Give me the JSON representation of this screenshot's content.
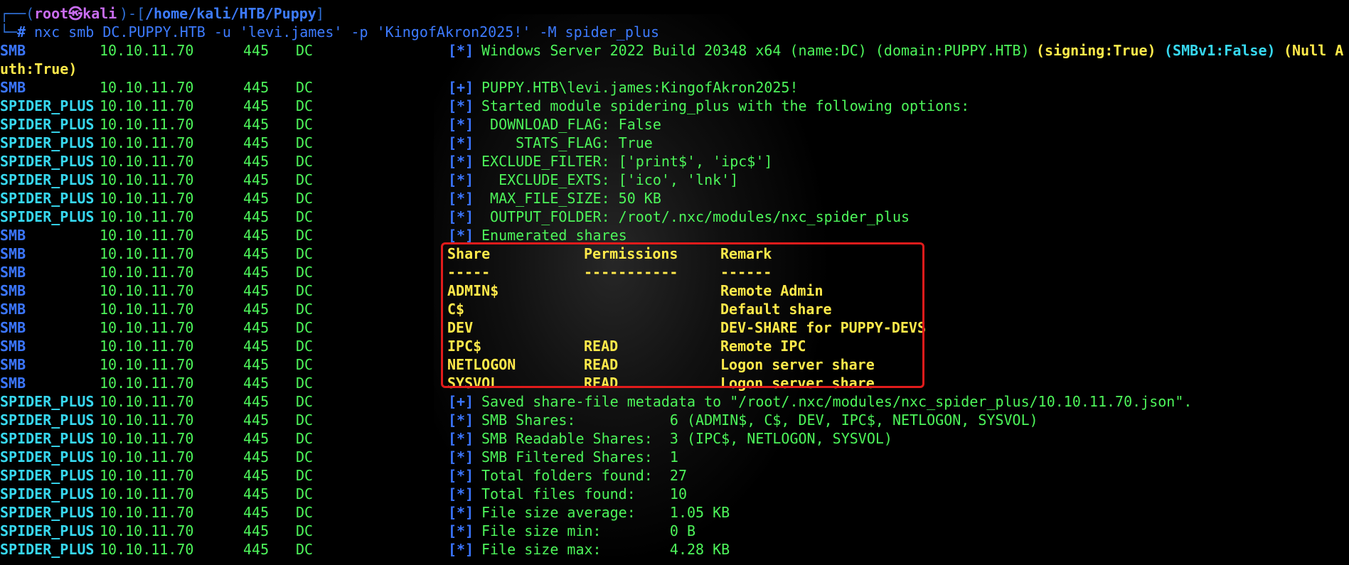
{
  "prompt": {
    "open": "┌──(",
    "user": "root㉿kali",
    "mid": ")-[",
    "path": "/home/kali/HTB/Puppy",
    "close": "]",
    "lead": "└─",
    "symbol": "#",
    "command": "nxc smb DC.PUPPY.HTB -u 'levi.james' -p 'KingofAkron2025!' -M spider_plus"
  },
  "rows": [
    {
      "proto": "SMB",
      "kind": "smb",
      "ip": "10.10.11.70",
      "port": "445",
      "host": "DC",
      "tag": "[*]",
      "msg": "Windows Server 2022 Build 20348 x64 (name:DC) (domain:PUPPY.HTB) ",
      "msg2": "(signing:True) ",
      "msg3": "(SMBv1:False) ",
      "msg4": "(Null A"
    },
    {
      "wrap": "uth:True)"
    },
    {
      "proto": "SMB",
      "kind": "smb",
      "ip": "10.10.11.70",
      "port": "445",
      "host": "DC",
      "tag": "[+]",
      "msg": "PUPPY.HTB\\levi.james:KingofAkron2025!"
    },
    {
      "proto": "SPIDER_PLUS",
      "kind": "spider",
      "ip": "10.10.11.70",
      "port": "445",
      "host": "DC",
      "tag": "[*]",
      "msg": "Started module spidering_plus with the following options:"
    },
    {
      "proto": "SPIDER_PLUS",
      "kind": "spider",
      "ip": "10.10.11.70",
      "port": "445",
      "host": "DC",
      "tag": "[*]",
      "msg": " DOWNLOAD_FLAG: False"
    },
    {
      "proto": "SPIDER_PLUS",
      "kind": "spider",
      "ip": "10.10.11.70",
      "port": "445",
      "host": "DC",
      "tag": "[*]",
      "msg": "    STATS_FLAG: True"
    },
    {
      "proto": "SPIDER_PLUS",
      "kind": "spider",
      "ip": "10.10.11.70",
      "port": "445",
      "host": "DC",
      "tag": "[*]",
      "msg": "EXCLUDE_FILTER: ['print$', 'ipc$']"
    },
    {
      "proto": "SPIDER_PLUS",
      "kind": "spider",
      "ip": "10.10.11.70",
      "port": "445",
      "host": "DC",
      "tag": "[*]",
      "msg": "  EXCLUDE_EXTS: ['ico', 'lnk']"
    },
    {
      "proto": "SPIDER_PLUS",
      "kind": "spider",
      "ip": "10.10.11.70",
      "port": "445",
      "host": "DC",
      "tag": "[*]",
      "msg": " MAX_FILE_SIZE: 50 KB"
    },
    {
      "proto": "SPIDER_PLUS",
      "kind": "spider",
      "ip": "10.10.11.70",
      "port": "445",
      "host": "DC",
      "tag": "[*]",
      "msg": " OUTPUT_FOLDER: /root/.nxc/modules/nxc_spider_plus"
    },
    {
      "proto": "SMB",
      "kind": "smb",
      "ip": "10.10.11.70",
      "port": "445",
      "host": "DC",
      "tag": "[*]",
      "msg": "Enumerated shares"
    },
    {
      "proto": "SMB",
      "kind": "smb",
      "ip": "10.10.11.70",
      "port": "445",
      "host": "DC",
      "share": "Share",
      "perm": "Permissions",
      "remark": "Remark"
    },
    {
      "proto": "SMB",
      "kind": "smb",
      "ip": "10.10.11.70",
      "port": "445",
      "host": "DC",
      "share": "-----",
      "perm": "-----------",
      "remark": "------"
    },
    {
      "proto": "SMB",
      "kind": "smb",
      "ip": "10.10.11.70",
      "port": "445",
      "host": "DC",
      "share": "ADMIN$",
      "perm": "",
      "remark": "Remote Admin"
    },
    {
      "proto": "SMB",
      "kind": "smb",
      "ip": "10.10.11.70",
      "port": "445",
      "host": "DC",
      "share": "C$",
      "perm": "",
      "remark": "Default share"
    },
    {
      "proto": "SMB",
      "kind": "smb",
      "ip": "10.10.11.70",
      "port": "445",
      "host": "DC",
      "share": "DEV",
      "perm": "",
      "remark": "DEV-SHARE for PUPPY-DEVS"
    },
    {
      "proto": "SMB",
      "kind": "smb",
      "ip": "10.10.11.70",
      "port": "445",
      "host": "DC",
      "share": "IPC$",
      "perm": "READ",
      "remark": "Remote IPC"
    },
    {
      "proto": "SMB",
      "kind": "smb",
      "ip": "10.10.11.70",
      "port": "445",
      "host": "DC",
      "share": "NETLOGON",
      "perm": "READ",
      "remark": "Logon server share"
    },
    {
      "proto": "SMB",
      "kind": "smb",
      "ip": "10.10.11.70",
      "port": "445",
      "host": "DC",
      "share": "SYSVOL",
      "perm": "READ",
      "remark": "Logon server share"
    },
    {
      "proto": "SPIDER_PLUS",
      "kind": "spider",
      "ip": "10.10.11.70",
      "port": "445",
      "host": "DC",
      "tag": "[+]",
      "msg": "Saved share-file metadata to \"/root/.nxc/modules/nxc_spider_plus/10.10.11.70.json\"."
    },
    {
      "proto": "SPIDER_PLUS",
      "kind": "spider",
      "ip": "10.10.11.70",
      "port": "445",
      "host": "DC",
      "tag": "[*]",
      "msg": "SMB Shares:           6 (ADMIN$, C$, DEV, IPC$, NETLOGON, SYSVOL)"
    },
    {
      "proto": "SPIDER_PLUS",
      "kind": "spider",
      "ip": "10.10.11.70",
      "port": "445",
      "host": "DC",
      "tag": "[*]",
      "msg": "SMB Readable Shares:  3 (IPC$, NETLOGON, SYSVOL)"
    },
    {
      "proto": "SPIDER_PLUS",
      "kind": "spider",
      "ip": "10.10.11.70",
      "port": "445",
      "host": "DC",
      "tag": "[*]",
      "msg": "SMB Filtered Shares:  1"
    },
    {
      "proto": "SPIDER_PLUS",
      "kind": "spider",
      "ip": "10.10.11.70",
      "port": "445",
      "host": "DC",
      "tag": "[*]",
      "msg": "Total folders found:  27"
    },
    {
      "proto": "SPIDER_PLUS",
      "kind": "spider",
      "ip": "10.10.11.70",
      "port": "445",
      "host": "DC",
      "tag": "[*]",
      "msg": "Total files found:    10"
    },
    {
      "proto": "SPIDER_PLUS",
      "kind": "spider",
      "ip": "10.10.11.70",
      "port": "445",
      "host": "DC",
      "tag": "[*]",
      "msg": "File size average:    1.05 KB"
    },
    {
      "proto": "SPIDER_PLUS",
      "kind": "spider",
      "ip": "10.10.11.70",
      "port": "445",
      "host": "DC",
      "tag": "[*]",
      "msg": "File size min:        0 B"
    },
    {
      "proto": "SPIDER_PLUS",
      "kind": "spider",
      "ip": "10.10.11.70",
      "port": "445",
      "host": "DC",
      "tag": "[*]",
      "msg": "File size max:        4.28 KB"
    }
  ]
}
